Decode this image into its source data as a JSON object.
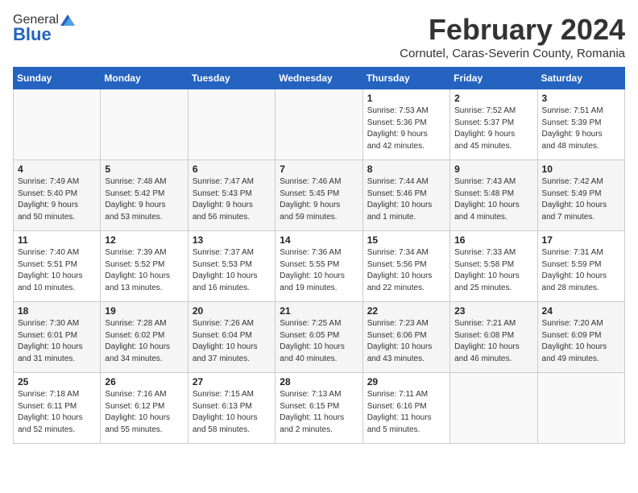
{
  "logo": {
    "general": "General",
    "blue": "Blue"
  },
  "header": {
    "month": "February 2024",
    "location": "Cornutel, Caras-Severin County, Romania"
  },
  "weekdays": [
    "Sunday",
    "Monday",
    "Tuesday",
    "Wednesday",
    "Thursday",
    "Friday",
    "Saturday"
  ],
  "weeks": [
    [
      {
        "day": "",
        "info": ""
      },
      {
        "day": "",
        "info": ""
      },
      {
        "day": "",
        "info": ""
      },
      {
        "day": "",
        "info": ""
      },
      {
        "day": "1",
        "info": "Sunrise: 7:53 AM\nSunset: 5:36 PM\nDaylight: 9 hours\nand 42 minutes."
      },
      {
        "day": "2",
        "info": "Sunrise: 7:52 AM\nSunset: 5:37 PM\nDaylight: 9 hours\nand 45 minutes."
      },
      {
        "day": "3",
        "info": "Sunrise: 7:51 AM\nSunset: 5:39 PM\nDaylight: 9 hours\nand 48 minutes."
      }
    ],
    [
      {
        "day": "4",
        "info": "Sunrise: 7:49 AM\nSunset: 5:40 PM\nDaylight: 9 hours\nand 50 minutes."
      },
      {
        "day": "5",
        "info": "Sunrise: 7:48 AM\nSunset: 5:42 PM\nDaylight: 9 hours\nand 53 minutes."
      },
      {
        "day": "6",
        "info": "Sunrise: 7:47 AM\nSunset: 5:43 PM\nDaylight: 9 hours\nand 56 minutes."
      },
      {
        "day": "7",
        "info": "Sunrise: 7:46 AM\nSunset: 5:45 PM\nDaylight: 9 hours\nand 59 minutes."
      },
      {
        "day": "8",
        "info": "Sunrise: 7:44 AM\nSunset: 5:46 PM\nDaylight: 10 hours\nand 1 minute."
      },
      {
        "day": "9",
        "info": "Sunrise: 7:43 AM\nSunset: 5:48 PM\nDaylight: 10 hours\nand 4 minutes."
      },
      {
        "day": "10",
        "info": "Sunrise: 7:42 AM\nSunset: 5:49 PM\nDaylight: 10 hours\nand 7 minutes."
      }
    ],
    [
      {
        "day": "11",
        "info": "Sunrise: 7:40 AM\nSunset: 5:51 PM\nDaylight: 10 hours\nand 10 minutes."
      },
      {
        "day": "12",
        "info": "Sunrise: 7:39 AM\nSunset: 5:52 PM\nDaylight: 10 hours\nand 13 minutes."
      },
      {
        "day": "13",
        "info": "Sunrise: 7:37 AM\nSunset: 5:53 PM\nDaylight: 10 hours\nand 16 minutes."
      },
      {
        "day": "14",
        "info": "Sunrise: 7:36 AM\nSunset: 5:55 PM\nDaylight: 10 hours\nand 19 minutes."
      },
      {
        "day": "15",
        "info": "Sunrise: 7:34 AM\nSunset: 5:56 PM\nDaylight: 10 hours\nand 22 minutes."
      },
      {
        "day": "16",
        "info": "Sunrise: 7:33 AM\nSunset: 5:58 PM\nDaylight: 10 hours\nand 25 minutes."
      },
      {
        "day": "17",
        "info": "Sunrise: 7:31 AM\nSunset: 5:59 PM\nDaylight: 10 hours\nand 28 minutes."
      }
    ],
    [
      {
        "day": "18",
        "info": "Sunrise: 7:30 AM\nSunset: 6:01 PM\nDaylight: 10 hours\nand 31 minutes."
      },
      {
        "day": "19",
        "info": "Sunrise: 7:28 AM\nSunset: 6:02 PM\nDaylight: 10 hours\nand 34 minutes."
      },
      {
        "day": "20",
        "info": "Sunrise: 7:26 AM\nSunset: 6:04 PM\nDaylight: 10 hours\nand 37 minutes."
      },
      {
        "day": "21",
        "info": "Sunrise: 7:25 AM\nSunset: 6:05 PM\nDaylight: 10 hours\nand 40 minutes."
      },
      {
        "day": "22",
        "info": "Sunrise: 7:23 AM\nSunset: 6:06 PM\nDaylight: 10 hours\nand 43 minutes."
      },
      {
        "day": "23",
        "info": "Sunrise: 7:21 AM\nSunset: 6:08 PM\nDaylight: 10 hours\nand 46 minutes."
      },
      {
        "day": "24",
        "info": "Sunrise: 7:20 AM\nSunset: 6:09 PM\nDaylight: 10 hours\nand 49 minutes."
      }
    ],
    [
      {
        "day": "25",
        "info": "Sunrise: 7:18 AM\nSunset: 6:11 PM\nDaylight: 10 hours\nand 52 minutes."
      },
      {
        "day": "26",
        "info": "Sunrise: 7:16 AM\nSunset: 6:12 PM\nDaylight: 10 hours\nand 55 minutes."
      },
      {
        "day": "27",
        "info": "Sunrise: 7:15 AM\nSunset: 6:13 PM\nDaylight: 10 hours\nand 58 minutes."
      },
      {
        "day": "28",
        "info": "Sunrise: 7:13 AM\nSunset: 6:15 PM\nDaylight: 11 hours\nand 2 minutes."
      },
      {
        "day": "29",
        "info": "Sunrise: 7:11 AM\nSunset: 6:16 PM\nDaylight: 11 hours\nand 5 minutes."
      },
      {
        "day": "",
        "info": ""
      },
      {
        "day": "",
        "info": ""
      }
    ]
  ]
}
